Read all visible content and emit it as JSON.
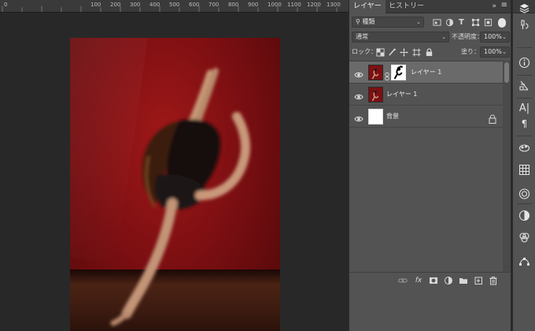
{
  "ruler": {
    "labels": [
      "0",
      "100",
      "200",
      "300",
      "400",
      "500",
      "600",
      "700",
      "800",
      "900",
      "1000",
      "1100",
      "1200",
      "1300"
    ]
  },
  "panel": {
    "tabs": {
      "layers": "レイヤー",
      "history": "ヒストリー"
    },
    "collapse": "»",
    "filter": {
      "kind_label": "種類"
    },
    "blend": {
      "mode": "通常",
      "opacity_label": "不透明度：",
      "opacity_value": "100%"
    },
    "lock": {
      "label": "ロック：",
      "fill_label": "塗り：",
      "fill_value": "100%"
    },
    "layers": [
      {
        "name": "レイヤー 1",
        "selected": true,
        "has_mask": true
      },
      {
        "name": "レイヤー 1",
        "selected": false,
        "has_mask": false
      },
      {
        "name": "背景",
        "selected": false,
        "has_mask": false,
        "locked": true
      }
    ],
    "footer": {
      "fx": "fx"
    }
  },
  "icons": {
    "toolbar": [
      "layers-icon",
      "adjust-panel-icon",
      "info-icon",
      "paragraph-panel-icon",
      "character-icon",
      "paragraph-icon",
      "channels-icon",
      "grid-icon",
      "libraries-icon",
      "adjustments-icon",
      "color-icon",
      "paths-icon"
    ]
  },
  "colors": {
    "panel_bg": "#535353",
    "canvas_bg": "#282828",
    "selected_layer": "#6a6a6a",
    "photo_red": "#8e1316"
  }
}
